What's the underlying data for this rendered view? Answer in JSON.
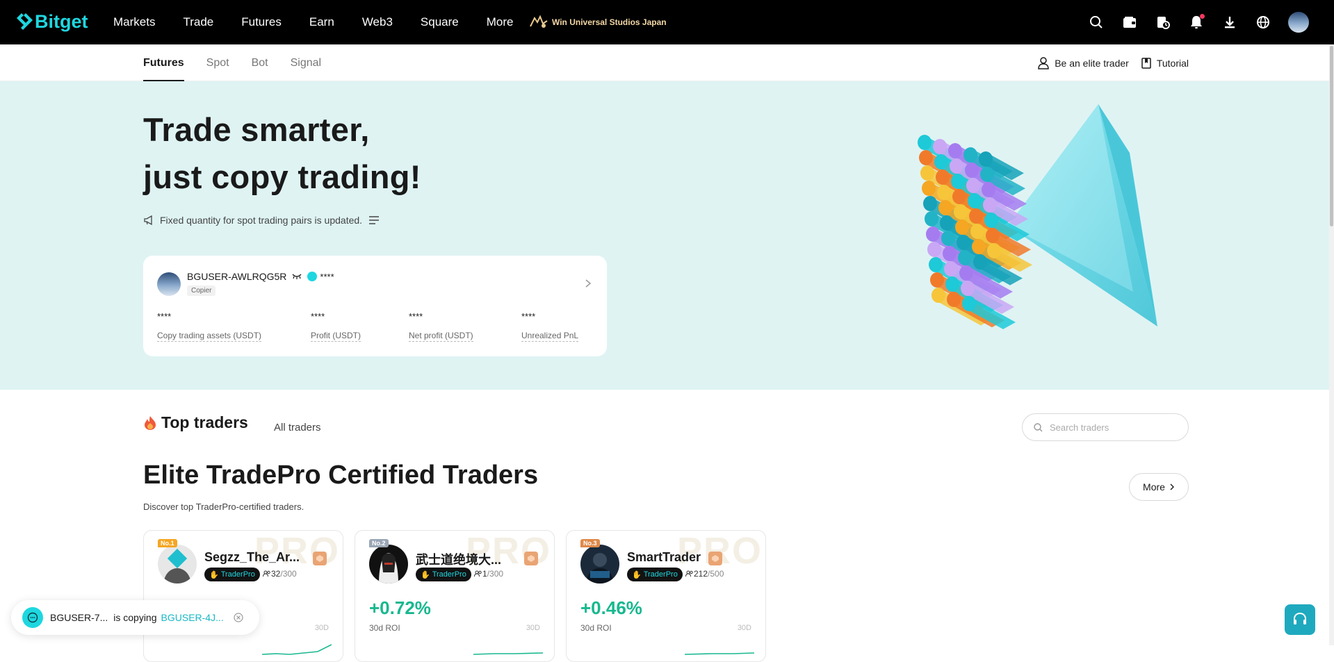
{
  "topnav": {
    "logo": "Bitget",
    "links": [
      "Markets",
      "Trade",
      "Futures",
      "Earn",
      "Web3",
      "Square",
      "More"
    ],
    "promo": "Win Universal Studios Japan",
    "icons": [
      "search-icon",
      "wallet-icon",
      "orders-icon",
      "bell-icon",
      "download-icon",
      "globe-icon"
    ]
  },
  "subnav": {
    "tabs": [
      "Futures",
      "Spot",
      "Bot",
      "Signal"
    ],
    "elite": "Be an elite trader",
    "tutorial": "Tutorial"
  },
  "hero": {
    "title_line1": "Trade smarter,",
    "title_line2": "just copy trading!",
    "notice": "Fixed quantity for spot trading pairs is updated.",
    "card": {
      "username": "BGUSER-AWLRQG5R",
      "hidden": "****",
      "role": "Copier",
      "stats": [
        {
          "value": "****",
          "label": "Copy trading assets (USDT)"
        },
        {
          "value": "****",
          "label": "Profit (USDT)"
        },
        {
          "value": "****",
          "label": "Net profit (USDT)"
        },
        {
          "value": "****",
          "label": "Unrealized PnL"
        }
      ]
    }
  },
  "top_traders": {
    "title": "Top traders",
    "all": "All traders",
    "search_placeholder": "Search traders"
  },
  "elite": {
    "title": "Elite TradePro Certified Traders",
    "subtitle": "Discover top TraderPro-certified traders.",
    "more": "More",
    "cards": [
      {
        "rank": "No.1",
        "name": "Segzz_The_Ar...",
        "badge": "TraderPro",
        "count": "32",
        "max": "/300",
        "roi": "",
        "roi_label": "",
        "period": "30D",
        "watermark": "PRO",
        "rank_color": "#f5a623"
      },
      {
        "rank": "No.2",
        "name": "武士道绝境大...",
        "badge": "TraderPro",
        "count": "1",
        "max": "/300",
        "roi": "+0.72%",
        "roi_label": "30d ROI",
        "period": "30D",
        "watermark": "PRO",
        "rank_color": "#9aa6b5"
      },
      {
        "rank": "No.3",
        "name": "SmartTrader",
        "badge": "TraderPro",
        "count": "212",
        "max": "/500",
        "roi": "+0.46%",
        "roi_label": "30d ROI",
        "period": "30D",
        "watermark": "PRO",
        "rank_color": "#e0894a"
      }
    ]
  },
  "toast": {
    "user": "BGUSER-7...",
    "text": "is copying",
    "target": "BGUSER-4J..."
  },
  "colors": {
    "accent": "#1ed7e0",
    "positive": "#18b88f",
    "hero_bg": "#dff3f3"
  }
}
